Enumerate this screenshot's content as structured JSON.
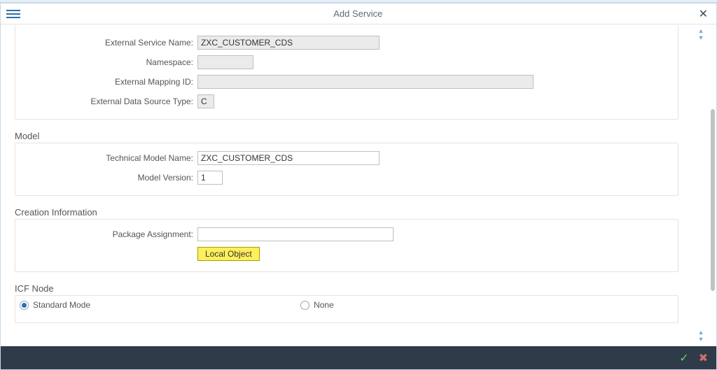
{
  "title": "Add Service",
  "top": {
    "ext_service_name_label": "External Service Name:",
    "ext_service_name_value": "ZXC_CUSTOMER_CDS",
    "namespace_label": "Namespace:",
    "namespace_value": "",
    "ext_mapping_id_label": "External Mapping ID:",
    "ext_mapping_id_value": "",
    "ext_ds_type_label": "External Data Source Type:",
    "ext_ds_type_value": "C"
  },
  "model": {
    "heading": "Model",
    "tech_model_name_label": "Technical Model Name:",
    "tech_model_name_value": "ZXC_CUSTOMER_CDS",
    "model_version_label": "Model Version:",
    "model_version_value": "1"
  },
  "creation": {
    "heading": "Creation Information",
    "package_label": "Package Assignment:",
    "package_value": "",
    "local_object_btn": "Local Object"
  },
  "icf": {
    "heading": "ICF Node",
    "option_standard": "Standard Mode",
    "option_none": "None",
    "selected": "standard"
  }
}
